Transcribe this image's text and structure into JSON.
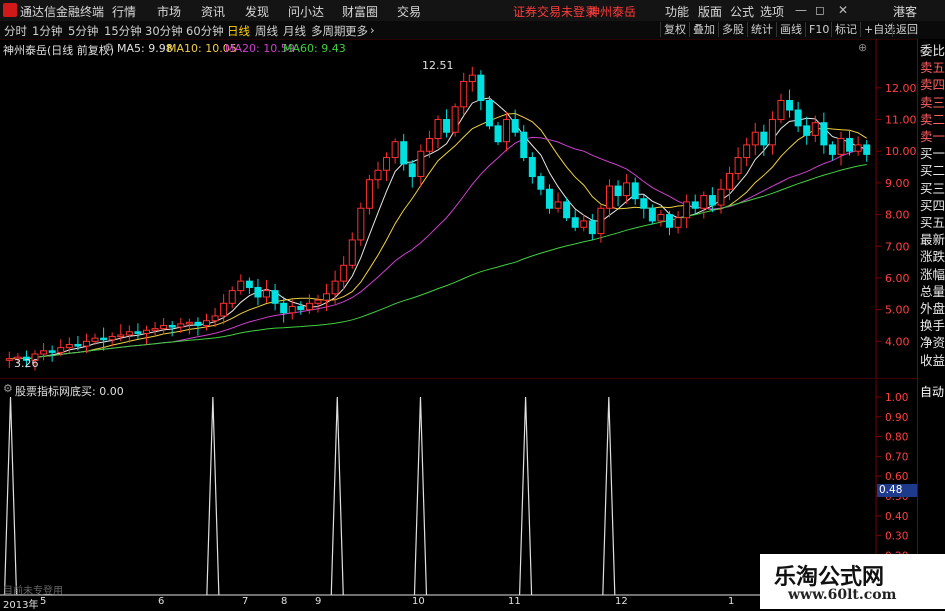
{
  "titlebar": {
    "app_name": "通达信金融终端",
    "menu": [
      "行情",
      "市场",
      "资讯",
      "发现",
      "问小达",
      "财富圈",
      "交易"
    ],
    "notice": "证券交易未登录",
    "stock_name": "神州泰岳",
    "right_menu": [
      "功能",
      "版面",
      "公式",
      "选项"
    ],
    "window_btn": "港客"
  },
  "periods": [
    "分时",
    "1分钟",
    "5分钟",
    "15分钟",
    "30分钟",
    "60分钟",
    "日线",
    "周线",
    "月线",
    "多周期",
    "更多"
  ],
  "active_period": "日线",
  "toolbar_right": [
    "复权",
    "叠加",
    "多股",
    "统计",
    "画线",
    "F10",
    "标记",
    "+自选",
    "返回"
  ],
  "chart_header": {
    "title": "神州泰岳(日线 前复权)",
    "ma5": "MA5: 9.98",
    "ma10": "MA10: 10.05",
    "ma20": "MA20: 10.59",
    "ma60": "MA60: 9.43"
  },
  "sub_header": {
    "title": "股票指标网",
    "value": "底买: 0.00"
  },
  "sub_current_value": "0.48",
  "sub_footer": "目前未专登用",
  "right_panel": [
    "委比",
    "卖五",
    "卖四",
    "卖三",
    "卖二",
    "卖一",
    "买一",
    "买二",
    "买三",
    "买四",
    "买五",
    "最新",
    "涨跌",
    "涨幅",
    "总量",
    "外盘",
    "换手",
    "净资",
    "收益"
  ],
  "auto_label": "自动",
  "x_labels": [
    "2013年",
    "5",
    "6",
    "7",
    "8",
    "9",
    "10",
    "11",
    "12",
    "1"
  ],
  "watermark": {
    "line1": "乐淘公式网",
    "line2": "www.60lt.com"
  },
  "chart_data": {
    "type": "candlestick",
    "y_ticks": [
      "12.00",
      "11.00",
      "10.00",
      "9.00",
      "8.00",
      "7.00",
      "6.00",
      "5.00",
      "4.00"
    ],
    "ylim": [
      3.0,
      13.1
    ],
    "high_label": "12.51",
    "low_label": "3.26",
    "close": [
      3.45,
      3.5,
      3.4,
      3.6,
      3.7,
      3.65,
      3.8,
      3.9,
      3.85,
      4.0,
      4.1,
      4.05,
      4.15,
      4.2,
      4.3,
      4.25,
      4.35,
      4.4,
      4.5,
      4.45,
      4.55,
      4.6,
      4.5,
      4.65,
      4.8,
      5.2,
      5.6,
      5.9,
      5.7,
      5.4,
      5.6,
      5.2,
      4.9,
      5.1,
      5.0,
      5.2,
      5.3,
      5.5,
      5.9,
      6.4,
      7.2,
      8.2,
      9.1,
      9.4,
      9.8,
      10.3,
      9.6,
      9.2,
      10.0,
      10.4,
      11.0,
      10.6,
      11.4,
      12.2,
      12.4,
      11.6,
      10.8,
      10.3,
      11.0,
      10.6,
      9.8,
      9.2,
      8.8,
      8.2,
      8.4,
      7.9,
      7.6,
      7.8,
      7.4,
      8.2,
      8.9,
      8.6,
      9.0,
      8.5,
      8.2,
      7.8,
      8.0,
      7.6,
      7.9,
      8.4,
      8.2,
      8.6,
      8.3,
      8.8,
      9.3,
      9.8,
      10.2,
      10.6,
      10.2,
      11.0,
      11.6,
      11.3,
      10.8,
      10.5,
      10.9,
      10.2,
      9.9,
      10.4,
      10.0,
      10.2,
      9.9
    ],
    "y2_ticks": [
      "1.00",
      "0.90",
      "0.80",
      "0.70",
      "0.60",
      "0.50",
      "0.40",
      "0.30",
      "0.20",
      "0.10"
    ],
    "signal_positions": [
      0.012,
      0.243,
      0.385,
      0.48,
      0.6,
      0.695
    ]
  }
}
